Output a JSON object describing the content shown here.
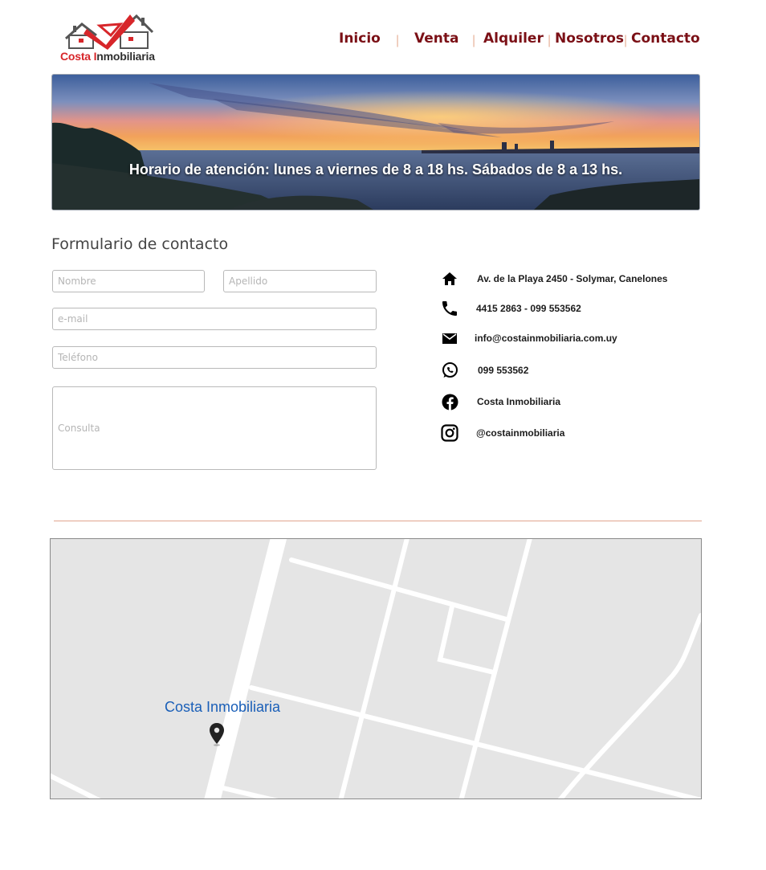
{
  "brand": {
    "logo_part1": "Costa ",
    "logo_part2_red": "I",
    "logo_part3": "nmobiliaria",
    "accent_color": "#7b1016",
    "logo_red": "#d7262a"
  },
  "nav": {
    "items": [
      {
        "label": "Inicio"
      },
      {
        "label": "Venta"
      },
      {
        "label": "Alquiler"
      },
      {
        "label": "Nosotros"
      },
      {
        "label": "Contacto"
      }
    ],
    "separator": "|"
  },
  "banner": {
    "text": "Horario de atención: lunes a viernes de 8 a 18 hs. Sábados de 8 a 13 hs."
  },
  "form": {
    "title": "Formulario de contacto",
    "name_placeholder": "Nombre",
    "surname_placeholder": "Apellido",
    "email_placeholder": "e-mail",
    "phone_placeholder": "Teléfono",
    "query_placeholder": "Consulta"
  },
  "contact": {
    "address": "Av. de la Playa 2450 - Solymar, Canelones",
    "phones": "4415 2863 - 099 553562",
    "email": "info@costainmobiliaria.com.uy",
    "whatsapp": "099 553562",
    "facebook": "Costa Inmobiliaria",
    "instagram": "@costainmobiliaria",
    "icons": [
      "home-icon",
      "phone-icon",
      "mail-icon",
      "whatsapp-icon",
      "facebook-icon",
      "instagram-icon"
    ]
  },
  "map": {
    "place_label": "Costa Inmobiliaria"
  }
}
